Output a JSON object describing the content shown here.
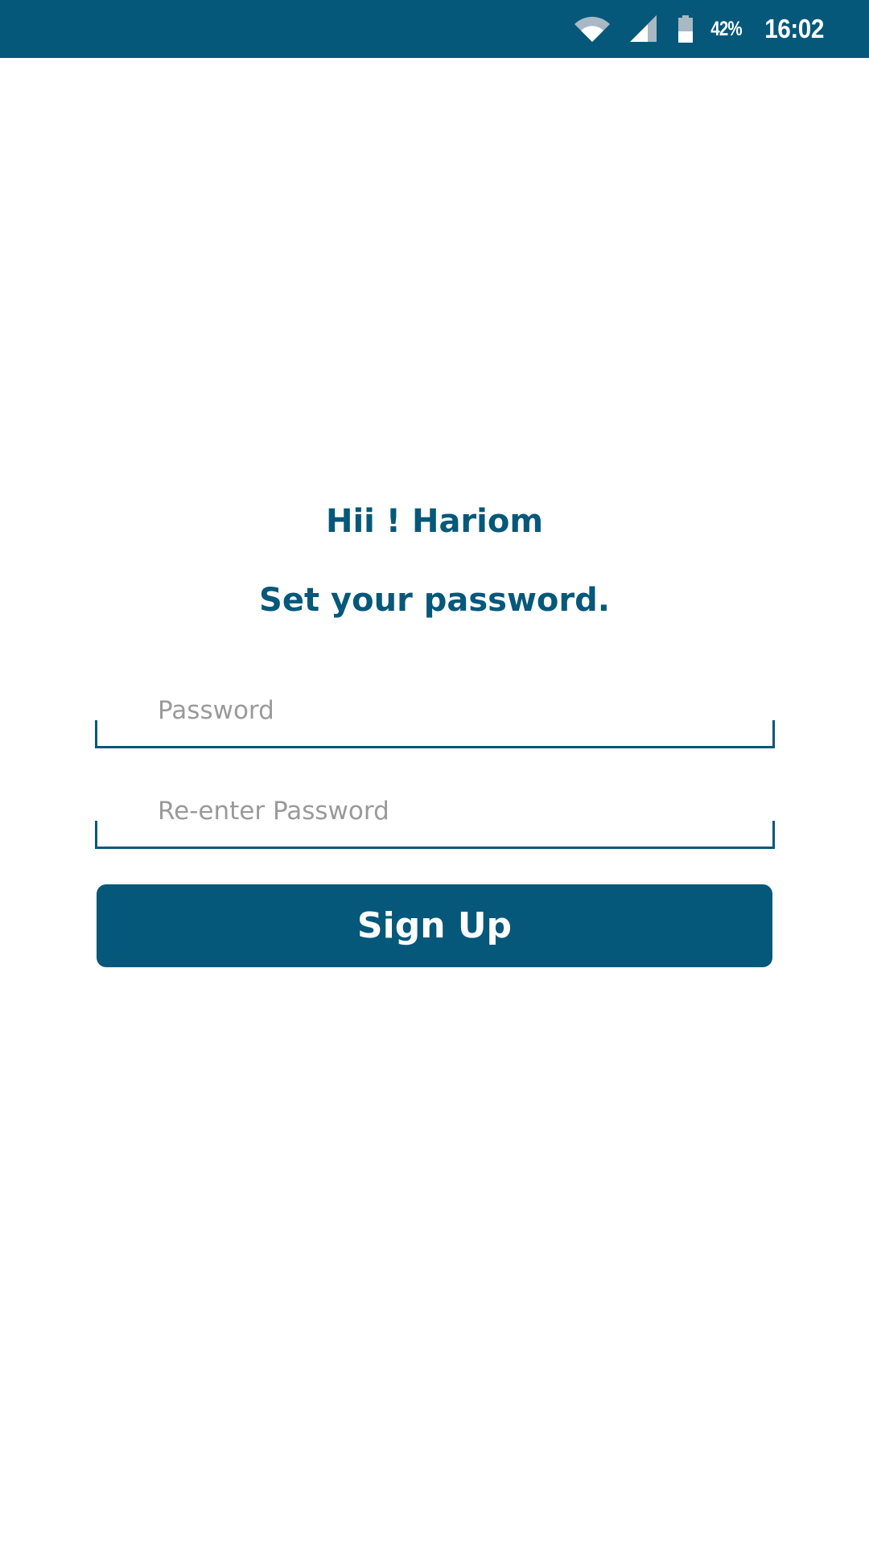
{
  "status_bar": {
    "battery_percent": "42%",
    "time": "16:02",
    "background_color": "#05587a",
    "icons": [
      "wifi-icon",
      "signal-icon",
      "battery-icon"
    ]
  },
  "greeting": "Hii ! Hariom",
  "subtitle": "Set your password.",
  "form": {
    "password": {
      "value": "",
      "placeholder": "Password"
    },
    "confirm_password": {
      "value": "",
      "placeholder": "Re-enter Password"
    }
  },
  "signup_button": {
    "label": "Sign Up"
  },
  "colors": {
    "accent": "#05587a",
    "placeholder": "#9a9a9a"
  }
}
